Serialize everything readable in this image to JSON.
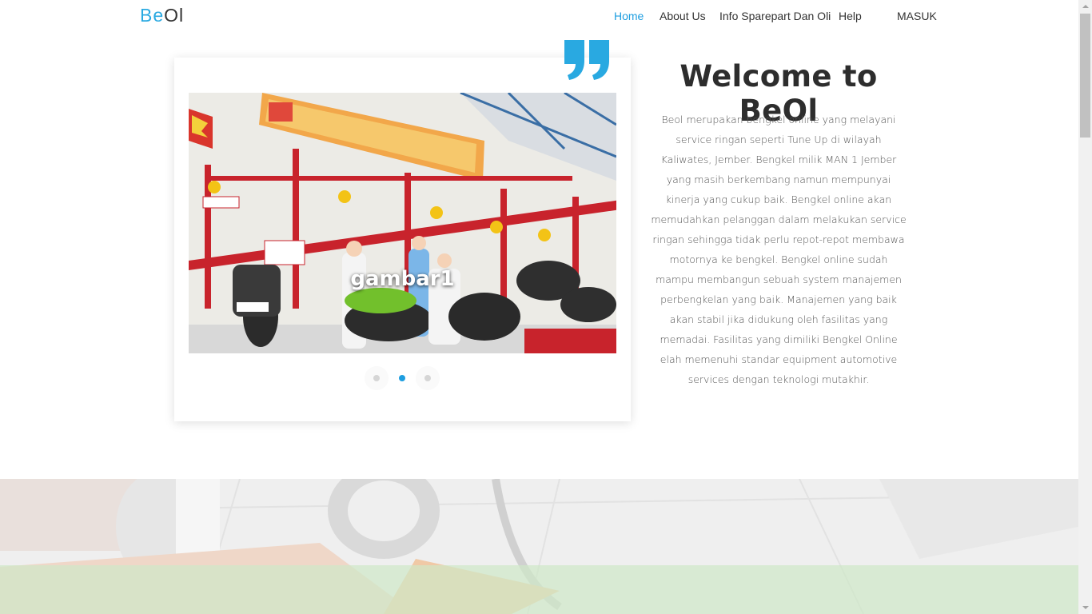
{
  "nav": {
    "brand_part1": "Be",
    "brand_part2": "Ol",
    "items": [
      {
        "label": "Home",
        "active": true
      },
      {
        "label": "About Us"
      },
      {
        "label": "Info Sparepart Dan Oli"
      },
      {
        "label": "Help"
      },
      {
        "label": "MASUK"
      }
    ]
  },
  "slider": {
    "caption": "gambar1",
    "active_index": 1,
    "dot_count": 3
  },
  "welcome": {
    "title": "Welcome to BeOl",
    "text": "Beol merupakan bengkel online yang melayani service ringan seperti Tune Up di wilayah Kaliwates, Jember. Bengkel milik MAN 1 Jember yang masih berkembang namun mempunyai kinerja yang cukup baik. Bengkel online akan memudahkan pelanggan dalam melakukan service ringan sehingga tidak perlu repot-repot membawa motornya ke bengkel. Bengkel online sudah mampu membangun sebuah system manajemen perbengkelan yang baik. Manajemen yang baik akan stabil jika didukung oleh fasilitas yang memadai. Fasilitas yang dimiliki Bengkel Online elah memenuhi standar equipment automotive services dengan teknologi mutakhir."
  },
  "colors": {
    "accent": "#1e9ee0",
    "quote": "#29a9e1"
  },
  "icons": {
    "quote": "quote-icon"
  }
}
